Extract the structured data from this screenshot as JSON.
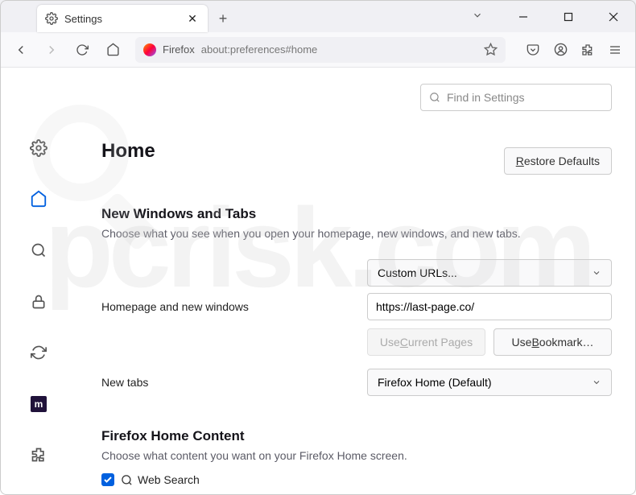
{
  "tab": {
    "title": "Settings"
  },
  "url": {
    "host": "Firefox",
    "rest": "about:preferences#home"
  },
  "search": {
    "placeholder": "Find in Settings"
  },
  "page": {
    "title": "Home",
    "restore": "Restore Defaults",
    "section1": {
      "heading": "New Windows and Tabs",
      "desc": "Choose what you see when you open your homepage, new windows, and new tabs.",
      "row1_label": "Homepage and new windows",
      "row1_select": "Custom URLs...",
      "row1_input": "https://last-page.co/",
      "use_current": "Use Current Pages",
      "use_bookmark": "Use Bookmark…",
      "row2_label": "New tabs",
      "row2_select": "Firefox Home (Default)"
    },
    "section2": {
      "heading": "Firefox Home Content",
      "desc": "Choose what content you want on your Firefox Home screen.",
      "websearch": "Web Search"
    }
  }
}
